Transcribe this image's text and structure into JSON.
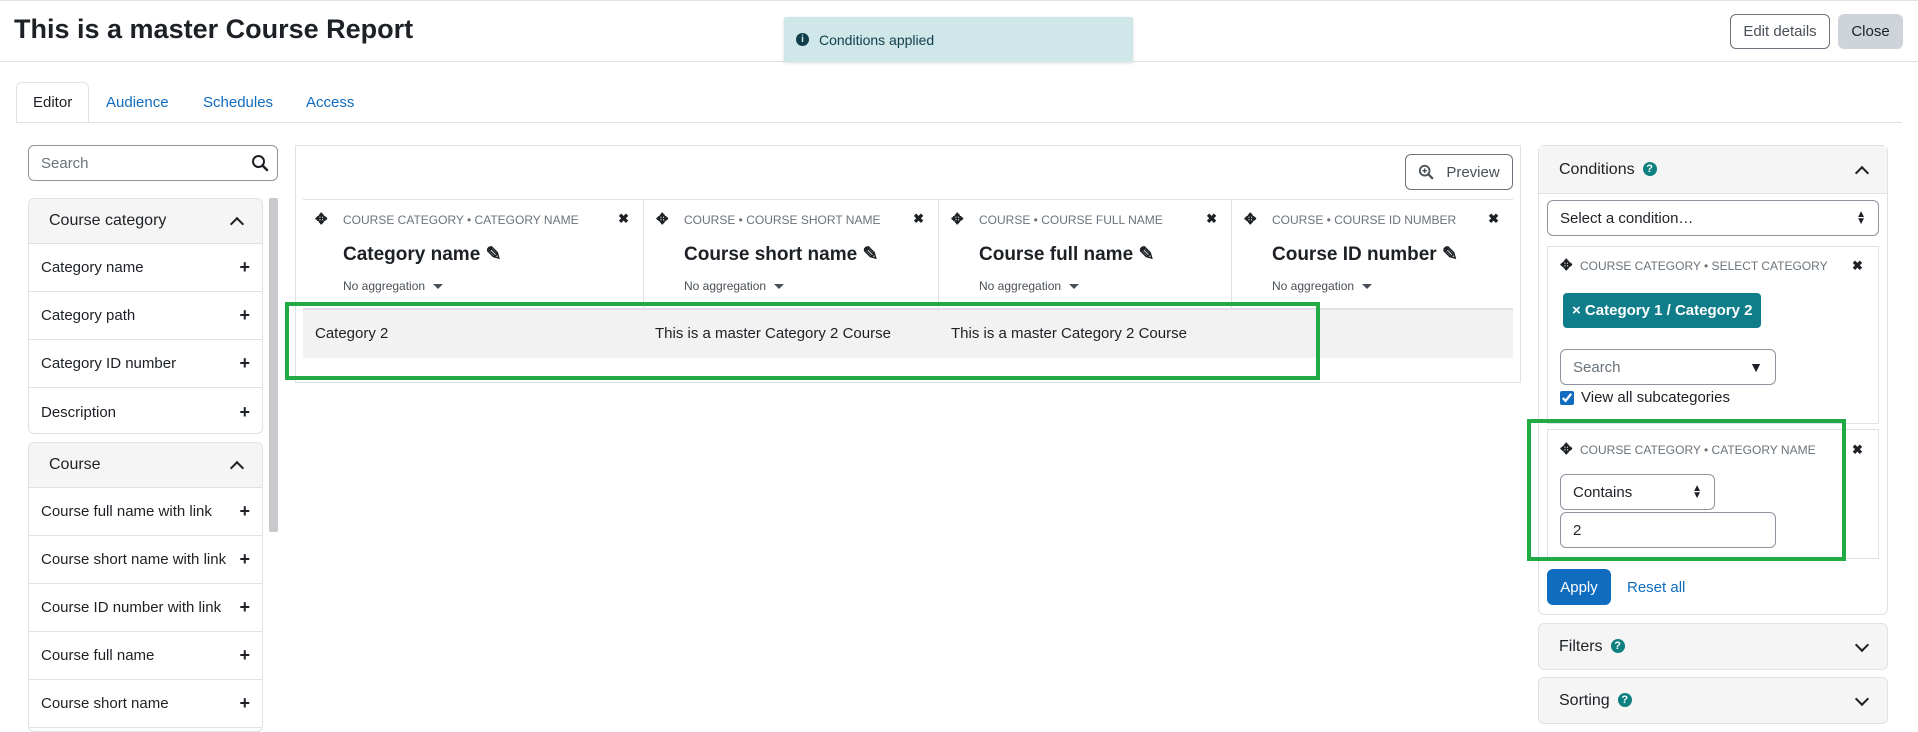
{
  "page": {
    "title": "This is a master Course Report",
    "edit_details_label": "Edit details",
    "close_label": "Close"
  },
  "toast": {
    "message": "Conditions applied"
  },
  "tabs": [
    {
      "label": "Editor"
    },
    {
      "label": "Audience"
    },
    {
      "label": "Schedules"
    },
    {
      "label": "Access"
    }
  ],
  "sidebar": {
    "search_placeholder": "Search",
    "groups": [
      {
        "title": "Course category",
        "items": [
          "Category name",
          "Category path",
          "Category ID number",
          "Description"
        ]
      },
      {
        "title": "Course",
        "items": [
          "Course full name with link",
          "Course short name with link",
          "Course ID number with link",
          "Course full name",
          "Course short name"
        ]
      }
    ]
  },
  "report": {
    "preview_label": "Preview",
    "columns": [
      {
        "caption": "COURSE CATEGORY • CATEGORY NAME",
        "title": "Category name",
        "aggregation": "No aggregation"
      },
      {
        "caption": "COURSE • COURSE SHORT NAME",
        "title": "Course short name",
        "aggregation": "No aggregation"
      },
      {
        "caption": "COURSE • COURSE FULL NAME",
        "title": "Course full name",
        "aggregation": "No aggregation"
      },
      {
        "caption": "COURSE • COURSE ID NUMBER",
        "title": "Course ID number",
        "aggregation": "No aggregation"
      }
    ],
    "rows": [
      [
        "Category 2",
        "This is a master Category 2 Course",
        "This is a master Category 2 Course",
        ""
      ]
    ]
  },
  "conditions": {
    "title": "Conditions",
    "select_placeholder": "Select a condition…",
    "items": [
      {
        "caption": "COURSE CATEGORY • SELECT CATEGORY",
        "tag": "× Category 1 / Category 2",
        "search_placeholder": "Search",
        "checkbox_label": "View all subcategories",
        "checked": true
      },
      {
        "caption": "COURSE CATEGORY • CATEGORY NAME",
        "operator": "Contains",
        "value": "2"
      }
    ],
    "apply_label": "Apply",
    "reset_label": "Reset all"
  },
  "filters": {
    "title": "Filters"
  },
  "sorting": {
    "title": "Sorting"
  },
  "colors": {
    "primary": "#0f6cbf",
    "tag": "#0f7e8a",
    "highlight": "#22aa44",
    "toast_bg": "#d0e7ea"
  }
}
